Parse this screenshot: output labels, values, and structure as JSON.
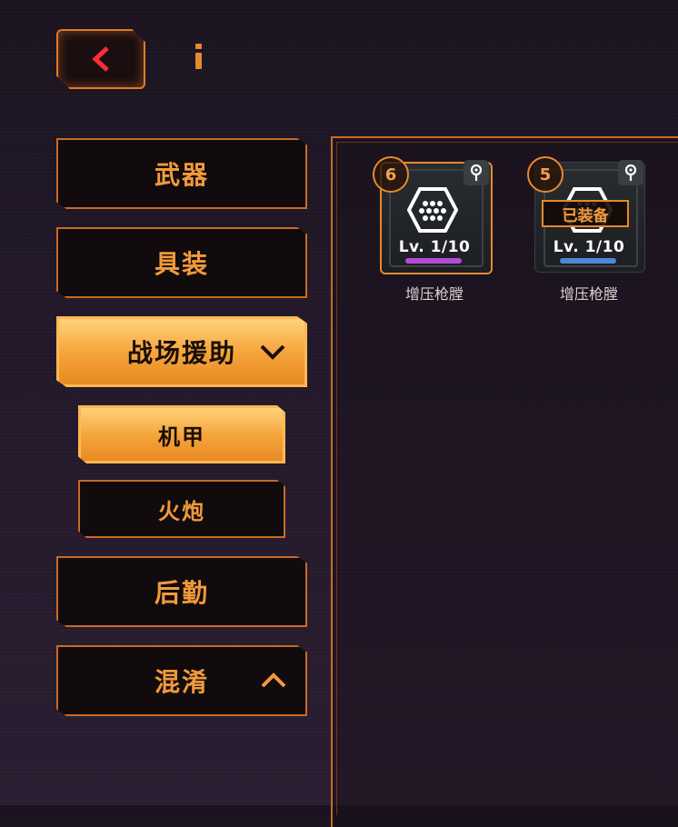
{
  "header": {
    "back_icon": "chevron-left-icon",
    "info_icon": "info-icon"
  },
  "sidebar": {
    "categories": [
      {
        "label": "武器",
        "active": false
      },
      {
        "label": "具装",
        "active": false
      },
      {
        "label": "战场援助",
        "active": true,
        "expanded": true,
        "chevron": "chevron-down-icon"
      },
      {
        "label": "后勤",
        "active": false
      },
      {
        "label": "混淆",
        "active": false,
        "chevron": "chevron-up-icon"
      }
    ],
    "subcategories": [
      {
        "label": "机甲",
        "active": true
      },
      {
        "label": "火炮",
        "active": false
      }
    ]
  },
  "items": [
    {
      "rank": "6",
      "level": "Lv. 1/10",
      "name": "增压枪膛",
      "rarity_color": "#b34cd6",
      "selected": true,
      "equipped": false,
      "icon": "hexagon-dots-icon",
      "pin_icon": "pin-icon"
    },
    {
      "rank": "5",
      "level": "Lv. 1/10",
      "name": "增压枪膛",
      "rarity_color": "#4f86d6",
      "selected": false,
      "equipped": true,
      "equipped_label": "已装备",
      "icon": "hexagon-dots-icon",
      "pin_icon": "pin-icon"
    }
  ],
  "colors": {
    "accent": "#e6892f",
    "active_fill": "#f5a63c",
    "background": "#221829"
  }
}
